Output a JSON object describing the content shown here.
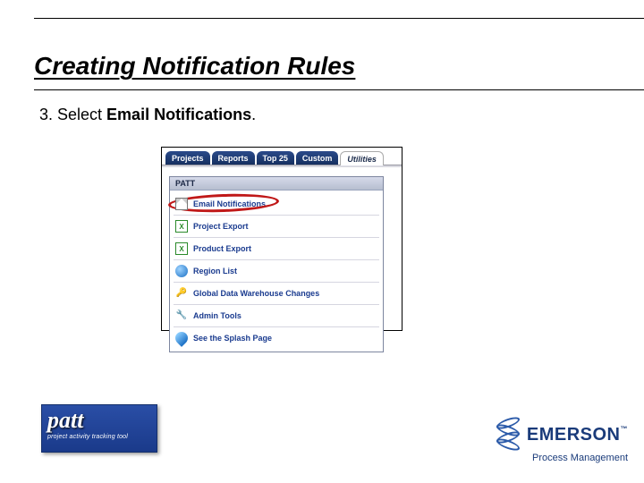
{
  "page": {
    "title": "Creating Notification Rules",
    "step_prefix": "3. Select ",
    "step_bold": "Email Notifications",
    "step_suffix": "."
  },
  "screenshot": {
    "tabs": [
      "Projects",
      "Reports",
      "Top 25",
      "Custom",
      "Utilities"
    ],
    "active_tab_index": 4,
    "panel_header": "PATT",
    "menu": [
      {
        "label": "Email Notifications",
        "icon": "mail",
        "highlighted": true
      },
      {
        "label": "Project Export",
        "icon": "excel"
      },
      {
        "label": "Product Export",
        "icon": "excel"
      },
      {
        "label": "Region List",
        "icon": "globe"
      },
      {
        "label": "Global Data Warehouse Changes",
        "icon": "key"
      },
      {
        "label": "Admin Tools",
        "icon": "admin"
      },
      {
        "label": "See the Splash Page",
        "icon": "drop"
      }
    ]
  },
  "branding": {
    "patt": {
      "big": "patt",
      "small": "project activity tracking tool"
    },
    "emerson": {
      "brand": "EMERSON",
      "tm": "™",
      "sub": "Process Management"
    }
  }
}
